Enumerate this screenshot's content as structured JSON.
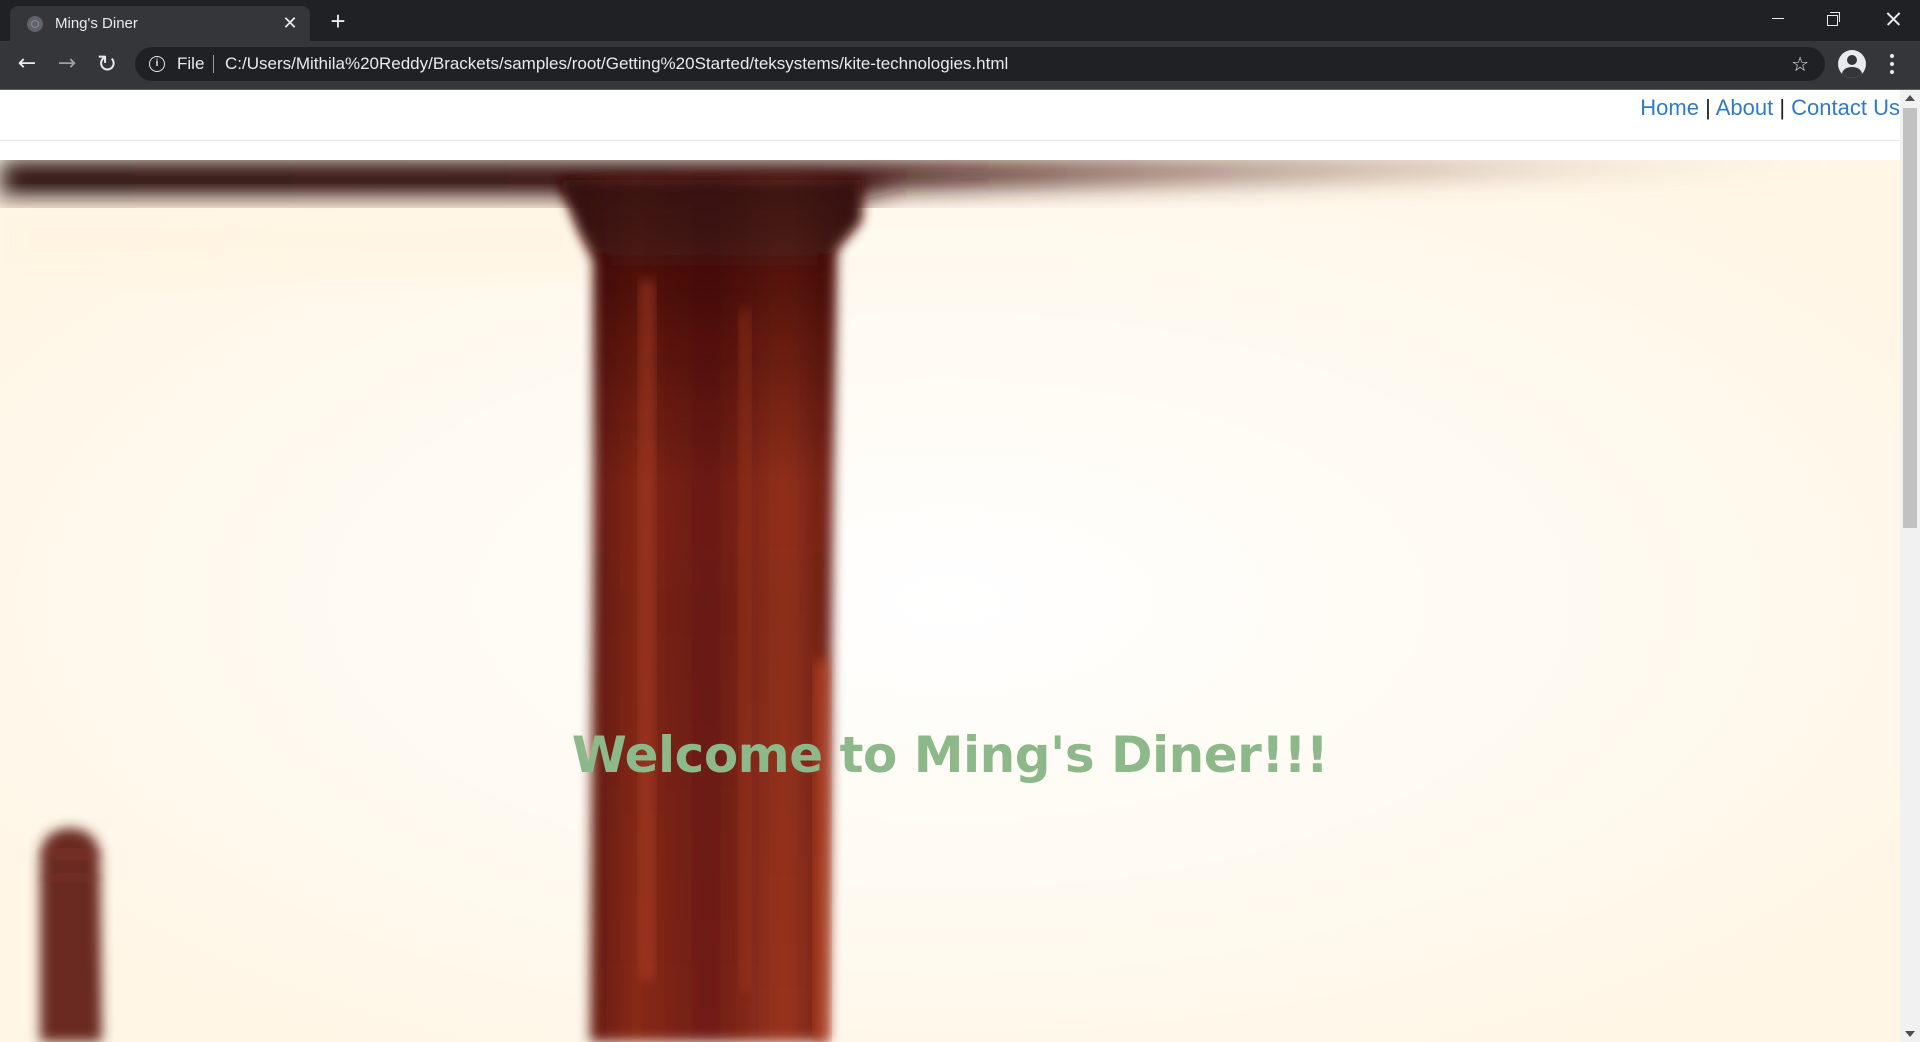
{
  "browser": {
    "tab_title": "Ming's Diner",
    "scheme_label": "File",
    "url": "C:/Users/Mithila%20Reddy/Brackets/samples/root/Getting%20Started/teksystems/kite-technologies.html"
  },
  "site": {
    "nav": {
      "home": "Home",
      "about": "About",
      "contact": "Contact Us",
      "separator": "|"
    },
    "hero_title": "Welcome to Ming's Diner!!!"
  },
  "colors": {
    "chrome_dark": "#202124",
    "chrome_toolbar": "#35363a",
    "link": "#2f7bc4",
    "hero_title": "#8db88a",
    "hero_pillar": "#7a1e12"
  }
}
